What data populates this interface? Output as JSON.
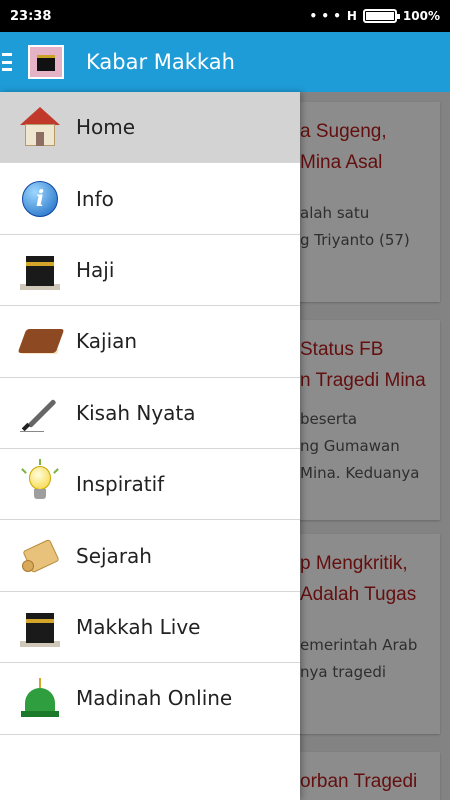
{
  "status_bar": {
    "time": "23:38",
    "notifications": "• • •",
    "network": "H",
    "battery_percent_label": "100%",
    "battery_level": 1.0
  },
  "app_bar": {
    "title": "Kabar Makkah",
    "menu_icon": "hamburger-menu-icon",
    "logo_icon": "kaaba-logo-icon",
    "color": "#1e9cd7"
  },
  "drawer": {
    "items": [
      {
        "label": "Home",
        "icon": "house-icon",
        "active": true
      },
      {
        "label": "Info",
        "icon": "info-icon",
        "active": false
      },
      {
        "label": "Haji",
        "icon": "kaaba-icon",
        "active": false
      },
      {
        "label": "Kajian",
        "icon": "book-icon",
        "active": false
      },
      {
        "label": "Kisah Nyata",
        "icon": "pen-icon",
        "active": false
      },
      {
        "label": "Inspiratif",
        "icon": "lightbulb-icon",
        "active": false
      },
      {
        "label": "Sejarah",
        "icon": "scroll-icon",
        "active": false
      },
      {
        "label": "Makkah Live",
        "icon": "kaaba-icon",
        "active": false
      },
      {
        "label": "Madinah Online",
        "icon": "mosque-dome-icon",
        "active": false
      }
    ]
  },
  "articles": [
    {
      "title_lines": [
        "a Sugeng,",
        "Mina Asal"
      ],
      "excerpt_lines": [
        "alah satu",
        "g Triyanto (57)"
      ]
    },
    {
      "title_lines": [
        "Status FB",
        "n Tragedi Mina"
      ],
      "excerpt_lines": [
        "beserta",
        "ng Gumawan",
        "Mina. Keduanya"
      ]
    },
    {
      "title_lines": [
        "p Mengkritik,",
        "Adalah Tugas"
      ],
      "excerpt_lines": [
        "emerintah Arab",
        "nya tragedi"
      ]
    },
    {
      "title_lines": [
        "orban Tragedi"
      ],
      "excerpt_lines": []
    }
  ],
  "colors": {
    "accent": "#1e9cd7",
    "article_title": "#b71c1c",
    "active_item_bg": "#d3d3d3"
  }
}
